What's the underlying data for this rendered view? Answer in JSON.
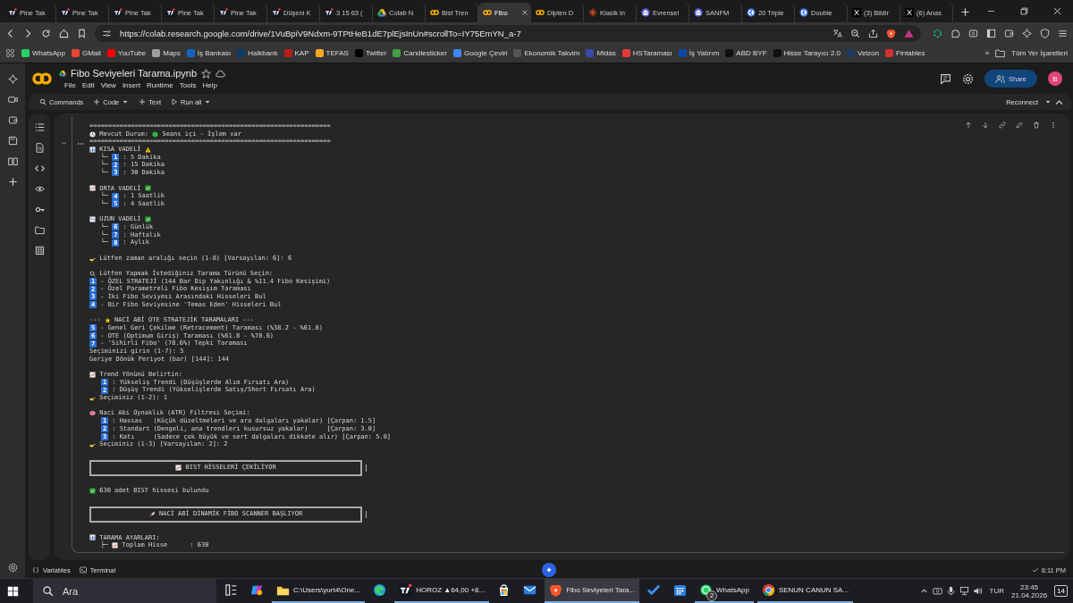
{
  "browser": {
    "tabs": [
      {
        "label": "Pine Tak",
        "kind": "tv",
        "selected": false
      },
      {
        "label": "Pine Tak",
        "kind": "tv",
        "selected": false
      },
      {
        "label": "Pine Tak",
        "kind": "tv",
        "selected": false
      },
      {
        "label": "Pine Tak",
        "kind": "tv",
        "selected": false
      },
      {
        "label": "Pine Tak",
        "kind": "tv",
        "selected": false
      },
      {
        "label": "Düşeni K",
        "kind": "tv",
        "selected": false
      },
      {
        "label": "3 15 63 (",
        "kind": "tv",
        "selected": false
      },
      {
        "label": "Colab N",
        "kind": "drive",
        "selected": false
      },
      {
        "label": "Bist Tren",
        "kind": "colab",
        "selected": false
      },
      {
        "label": "Fibo",
        "kind": "colab",
        "selected": true
      },
      {
        "label": "Dipten D",
        "kind": "colab",
        "selected": false
      },
      {
        "label": "Klasik in",
        "kind": "burst",
        "selected": false
      },
      {
        "label": "Evrensel",
        "kind": "ghost",
        "selected": false
      },
      {
        "label": "SANFM",
        "kind": "ghost",
        "selected": false
      },
      {
        "label": "20 Triple",
        "kind": "bluecircle",
        "selected": false
      },
      {
        "label": "Double",
        "kind": "bluecircle",
        "selected": false
      },
      {
        "label": "(3) Bildir",
        "kind": "x",
        "selected": false
      },
      {
        "label": "(6) Anas",
        "kind": "x",
        "selected": false
      }
    ],
    "url": "https://colab.research.google.com/drive/1VuBpiV9Ndxm-9TPtHeB1dE7plEjsInUn#scrollTo=IY75EmYN_a-7",
    "bookmarks": [
      {
        "label": "WhatsApp",
        "color": "#25d366"
      },
      {
        "label": "GMail",
        "color": "#ea4335"
      },
      {
        "label": "YouTube",
        "color": "#ff0000"
      },
      {
        "label": "Maps",
        "color": "#9e9e9e"
      },
      {
        "label": "İş Bankası",
        "color": "#1565c0"
      },
      {
        "label": "Halkbank",
        "color": "#0d3b66"
      },
      {
        "label": "KAP",
        "color": "#b71c1c"
      },
      {
        "label": "TEFAS",
        "color": "#f9a825"
      },
      {
        "label": "Twitter",
        "color": "#000000"
      },
      {
        "label": "Candlesticker",
        "color": "#43a047"
      },
      {
        "label": "Google Çeviri",
        "color": "#4285f4"
      },
      {
        "label": "Ekonomik Takvim",
        "color": "#555555"
      },
      {
        "label": "Midas",
        "color": "#3949ab"
      },
      {
        "label": "HSTaraması",
        "color": "#e53935"
      },
      {
        "label": "İş Yatırım",
        "color": "#0d47a1"
      },
      {
        "label": "ABD BYF",
        "color": "#111111"
      },
      {
        "label": "Hisse Tarayıcı 2.0",
        "color": "#111111"
      },
      {
        "label": "Velzon",
        "color": "#1e3a5f"
      },
      {
        "label": "Fintables",
        "color": "#d32f2f"
      }
    ],
    "more": "»",
    "all_bookmarks": "Tüm Yer İşaretleri"
  },
  "colab": {
    "title": "Fibo Seviyeleri Tarama.ipynb",
    "menu": [
      "File",
      "Edit",
      "View",
      "Insert",
      "Runtime",
      "Tools",
      "Help"
    ],
    "share": "Share",
    "avatar": "B",
    "toolbar": [
      {
        "label": "Commands",
        "kind": "search",
        "dropdown": false
      },
      {
        "label": "Code",
        "kind": "plus",
        "dropdown": true
      },
      {
        "label": "Text",
        "kind": "plus",
        "dropdown": false
      },
      {
        "label": "Run all",
        "kind": "play",
        "dropdown": true
      }
    ],
    "connect": "Reconnect",
    "output": [
      {
        "kind": "rule",
        "text": "================================================================"
      },
      {
        "kind": "line",
        "parts": [
          {
            "kind": "clock"
          },
          {
            "kind": "text",
            "text": " Mevcut Durum: "
          },
          {
            "kind": "dot"
          },
          {
            "kind": "text",
            "text": " Seans içi - İşlem var"
          }
        ]
      },
      {
        "kind": "rule",
        "text": "================================================================"
      },
      {
        "kind": "line",
        "parts": [
          {
            "kind": "chart"
          },
          {
            "kind": "text",
            "text": " KISA VADELİ "
          },
          {
            "kind": "warn"
          }
        ]
      },
      {
        "kind": "line",
        "parts": [
          {
            "kind": "text",
            "text": "   └─ "
          },
          {
            "kind": "badge",
            "text": "1"
          },
          {
            "kind": "text",
            "text": " : 5 Dakika"
          }
        ]
      },
      {
        "kind": "line",
        "parts": [
          {
            "kind": "text",
            "text": "   └─ "
          },
          {
            "kind": "badge",
            "text": "2"
          },
          {
            "kind": "text",
            "text": " : 15 Dakika"
          }
        ]
      },
      {
        "kind": "line",
        "parts": [
          {
            "kind": "text",
            "text": "   └─ "
          },
          {
            "kind": "badge",
            "text": "3"
          },
          {
            "kind": "text",
            "text": " : 30 Dakika"
          }
        ]
      },
      {
        "kind": "blank"
      },
      {
        "kind": "line",
        "parts": [
          {
            "kind": "up"
          },
          {
            "kind": "text",
            "text": " ORTA VADELİ "
          },
          {
            "kind": "check"
          }
        ]
      },
      {
        "kind": "line",
        "parts": [
          {
            "kind": "text",
            "text": "   └─ "
          },
          {
            "kind": "badge",
            "text": "4"
          },
          {
            "kind": "text",
            "text": " : 1 Saatlik"
          }
        ]
      },
      {
        "kind": "line",
        "parts": [
          {
            "kind": "text",
            "text": "   └─ "
          },
          {
            "kind": "badge",
            "text": "5"
          },
          {
            "kind": "text",
            "text": " : 4 Saatlik"
          }
        ]
      },
      {
        "kind": "blank"
      },
      {
        "kind": "line",
        "parts": [
          {
            "kind": "down"
          },
          {
            "kind": "text",
            "text": " UZUN VADELİ "
          },
          {
            "kind": "check"
          }
        ]
      },
      {
        "kind": "line",
        "parts": [
          {
            "kind": "text",
            "text": "   └─ "
          },
          {
            "kind": "badge",
            "text": "6"
          },
          {
            "kind": "text",
            "text": " : Günlük"
          }
        ]
      },
      {
        "kind": "line",
        "parts": [
          {
            "kind": "text",
            "text": "   └─ "
          },
          {
            "kind": "badge",
            "text": "7"
          },
          {
            "kind": "text",
            "text": " : Haftalık"
          }
        ]
      },
      {
        "kind": "line",
        "parts": [
          {
            "kind": "text",
            "text": "   └─ "
          },
          {
            "kind": "badge",
            "text": "8"
          },
          {
            "kind": "text",
            "text": " : Aylık"
          }
        ]
      },
      {
        "kind": "blank"
      },
      {
        "kind": "line",
        "parts": [
          {
            "kind": "hand"
          },
          {
            "kind": "text",
            "text": " Lütfen zaman aralığı seçin (1-8) [Varsayılan: 6]: 6"
          }
        ]
      },
      {
        "kind": "blank"
      },
      {
        "kind": "line",
        "parts": [
          {
            "kind": "search"
          },
          {
            "kind": "text",
            "text": " Lütfen Yapmak İstediğiniz Tarama Türünü Seçin:"
          }
        ]
      },
      {
        "kind": "line",
        "parts": [
          {
            "kind": "badge",
            "text": "1"
          },
          {
            "kind": "text",
            "text": " - ÖZEL STRATEJİ (144 Bar Dip Yakınlığı & %11.4 Fibo Kesişimi)"
          }
        ]
      },
      {
        "kind": "line",
        "parts": [
          {
            "kind": "badge",
            "text": "2"
          },
          {
            "kind": "text",
            "text": " - Özel Parametreli Fibo Kesişim Taraması"
          }
        ]
      },
      {
        "kind": "line",
        "parts": [
          {
            "kind": "badge",
            "text": "3"
          },
          {
            "kind": "text",
            "text": " - İki Fibo Seviyesi Arasındaki Hisseleri Bul"
          }
        ]
      },
      {
        "kind": "line",
        "parts": [
          {
            "kind": "badge",
            "text": "4"
          },
          {
            "kind": "text",
            "text": " - Bir Fibo Seviyesine 'Temas Eden' Hisseleri Bul"
          }
        ]
      },
      {
        "kind": "blank"
      },
      {
        "kind": "line",
        "parts": [
          {
            "kind": "text",
            "text": "--- "
          },
          {
            "kind": "star"
          },
          {
            "kind": "text",
            "text": " NACİ ABİ OTE STRATEJİK TARAMALARI ---"
          }
        ]
      },
      {
        "kind": "line",
        "parts": [
          {
            "kind": "badge",
            "text": "5"
          },
          {
            "kind": "text",
            "text": " - Genel Geri Çekilme (Retracement) Taraması (%38.2 - %61.8)"
          }
        ]
      },
      {
        "kind": "line",
        "parts": [
          {
            "kind": "badge",
            "text": "6"
          },
          {
            "kind": "text",
            "text": " - OTE (Optimum Giriş) Taraması (%61.8 - %78.6)"
          }
        ]
      },
      {
        "kind": "line",
        "parts": [
          {
            "kind": "badge",
            "text": "7"
          },
          {
            "kind": "text",
            "text": " - 'Sihirli Fibo' (78.6%) Tepki Taraması"
          }
        ]
      },
      {
        "kind": "line",
        "parts": [
          {
            "kind": "text",
            "text": "Seçiminizi girin (1-7): 5"
          }
        ]
      },
      {
        "kind": "line",
        "parts": [
          {
            "kind": "text",
            "text": "Geriye Dönük Periyot (bar) [144]: 144"
          }
        ]
      },
      {
        "kind": "blank"
      },
      {
        "kind": "line",
        "parts": [
          {
            "kind": "up"
          },
          {
            "kind": "text",
            "text": " Trend Yönünü Belirtin:"
          }
        ]
      },
      {
        "kind": "line",
        "indent": true,
        "parts": [
          {
            "kind": "badge",
            "text": "1"
          },
          {
            "kind": "text",
            "text": " : Yükseliş Trendi (Düşüşlerde Alım Fırsatı Ara)"
          }
        ]
      },
      {
        "kind": "line",
        "indent": true,
        "parts": [
          {
            "kind": "badge",
            "text": "2"
          },
          {
            "kind": "text",
            "text": " : Düşüş Trendi (Yükselişlerde Satış/Short Fırsatı Ara)"
          }
        ]
      },
      {
        "kind": "line",
        "parts": [
          {
            "kind": "hand"
          },
          {
            "kind": "text",
            "text": " Seçiminiz (1-2): 1"
          }
        ]
      },
      {
        "kind": "blank"
      },
      {
        "kind": "line",
        "parts": [
          {
            "kind": "brain"
          },
          {
            "kind": "text",
            "text": " Naci Abi Oynaklık (ATR) Filtresi Seçimi:"
          }
        ]
      },
      {
        "kind": "line",
        "indent": true,
        "parts": [
          {
            "kind": "badge",
            "text": "1"
          },
          {
            "kind": "text",
            "text": " : Hassas   (Küçük düzeltmeleri ve ara dalgaları yakalar) [Çarpan: 1.5]"
          }
        ]
      },
      {
        "kind": "line",
        "indent": true,
        "parts": [
          {
            "kind": "badge",
            "text": "2"
          },
          {
            "kind": "text",
            "text": " : Standart (Dengeli, ana trendleri kusursuz yakalar)     [Çarpan: 3.0]"
          }
        ]
      },
      {
        "kind": "line",
        "indent": true,
        "parts": [
          {
            "kind": "badge",
            "text": "3"
          },
          {
            "kind": "text",
            "text": " : Katı     (Sadece çok büyük ve sert dalgaları dikkate alır) [Çarpan: 5.0]"
          }
        ]
      },
      {
        "kind": "line",
        "parts": [
          {
            "kind": "hand"
          },
          {
            "kind": "text",
            "text": " Seçiminiz (1-3) [Varsayılan: 2]: 2"
          }
        ]
      },
      {
        "kind": "blank"
      },
      {
        "kind": "banner",
        "parts": [
          {
            "kind": "up"
          },
          {
            "kind": "text",
            "text": " BIST HİSSELERİ ÇEKİLİYOR"
          }
        ]
      },
      {
        "kind": "blank"
      },
      {
        "kind": "line",
        "parts": [
          {
            "kind": "check"
          },
          {
            "kind": "text",
            "text": " 630 adet BIST hissesi bulundu"
          }
        ]
      },
      {
        "kind": "blank"
      },
      {
        "kind": "banner",
        "parts": [
          {
            "kind": "rocket"
          },
          {
            "kind": "text",
            "text": " NACİ ABİ DİNAMİK FİBO SCANNER BAŞLIYOR"
          }
        ]
      },
      {
        "kind": "blank"
      },
      {
        "kind": "line",
        "parts": [
          {
            "kind": "chart"
          },
          {
            "kind": "text",
            "text": " TARAMA AYARLARI:"
          }
        ]
      },
      {
        "kind": "line",
        "parts": [
          {
            "kind": "text",
            "text": "   ├─ "
          },
          {
            "kind": "up"
          },
          {
            "kind": "text",
            "text": " Toplam Hisse      : 630"
          }
        ]
      }
    ],
    "bottom": [
      {
        "label": "Variables",
        "kind": "braces"
      },
      {
        "label": "Terminal",
        "kind": "terminal"
      }
    ],
    "status": "8:11 PM"
  },
  "taskbar": {
    "search": {
      "placeholder": "Ara"
    },
    "apps": [
      {
        "kind": "taskview",
        "running": false,
        "selected": false
      },
      {
        "kind": "copilot",
        "running": false,
        "selected": false
      },
      {
        "kind": "folder",
        "label": "C:\\Users\\yurt4\\One...",
        "running": true,
        "selected": false
      },
      {
        "kind": "edge",
        "running": false,
        "selected": false
      },
      {
        "kind": "tv",
        "label": "HOROZ ▲64,00 +8...",
        "running": true,
        "selected": false
      },
      {
        "kind": "store",
        "running": false,
        "selected": false
      },
      {
        "kind": "mail",
        "running": false,
        "selected": false
      },
      {
        "kind": "brave",
        "label": "Fibo Seviyeleri Tara...",
        "running": true,
        "selected": true
      },
      {
        "kind": "todo",
        "running": false,
        "selected": false
      },
      {
        "kind": "calendar",
        "running": false,
        "selected": false
      },
      {
        "kind": "whatsapp",
        "label": "WhatsApp",
        "badge": "2",
        "running": true,
        "selected": false
      },
      {
        "kind": "chrome",
        "label": "SENUN CANUN SA...",
        "running": true,
        "selected": false
      }
    ],
    "language": "TUR",
    "time": "23:45",
    "date": "21.04.2026",
    "notifications": "14"
  }
}
